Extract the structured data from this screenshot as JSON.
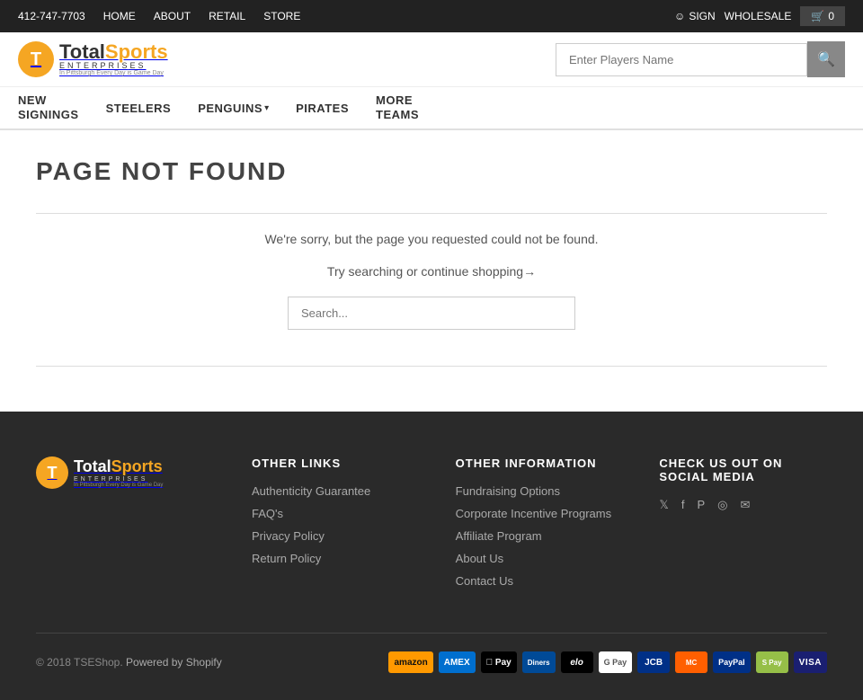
{
  "topbar": {
    "phone": "412-747-7703",
    "home_label": "HOME",
    "about_label": "ABOUT",
    "retail_label": "RETAIL",
    "store_label": "STORE",
    "sign_label": "SIGN",
    "wholesale_label": "WHOLESALE",
    "cart_count": "0"
  },
  "header": {
    "search_placeholder": "Enter Players Name"
  },
  "nav": {
    "items": [
      {
        "label": "NEW\nSIGNINGS",
        "has_arrow": false
      },
      {
        "label": "STEELERS",
        "has_arrow": false
      },
      {
        "label": "PENGUINS",
        "has_arrow": true
      },
      {
        "label": "PIRATES",
        "has_arrow": false
      },
      {
        "label": "MORE\nTEAMS",
        "has_arrow": false
      }
    ]
  },
  "main": {
    "title": "PAGE NOT FOUND",
    "error_message": "We're sorry, but the page you requested could not be found.",
    "search_prompt": "Try searching or ",
    "continue_link_text": "continue shopping→",
    "search_placeholder": "Search..."
  },
  "footer": {
    "other_links_title": "OTHER LINKS",
    "other_links": [
      {
        "label": "Authenticity Guarantee"
      },
      {
        "label": "FAQ's"
      },
      {
        "label": "Privacy Policy"
      },
      {
        "label": "Return Policy"
      }
    ],
    "other_info_title": "OTHER INFORMATION",
    "other_info": [
      {
        "label": "Fundraising Options"
      },
      {
        "label": "Corporate Incentive Programs"
      },
      {
        "label": "Affiliate Program"
      },
      {
        "label": "About Us"
      },
      {
        "label": "Contact Us"
      }
    ],
    "social_title": "CHECK US OUT ON\nSOCIAL MEDIA",
    "copyright": "© 2018 TSEShop.",
    "powered_by": "Powered by Shopify",
    "payment_methods": [
      {
        "label": "AMAZON",
        "class": "amazon"
      },
      {
        "label": "AMEX",
        "class": "amex"
      },
      {
        "label": "Apple Pay",
        "class": "apple"
      },
      {
        "label": "DINERS",
        "class": "diners"
      },
      {
        "label": "elo",
        "class": "elo"
      },
      {
        "label": "G Pay",
        "class": "google"
      },
      {
        "label": "JCB",
        "class": "jcb"
      },
      {
        "label": "MC",
        "class": "master"
      },
      {
        "label": "PayPal",
        "class": "paypal"
      },
      {
        "label": "S Pay",
        "class": "shopify"
      },
      {
        "label": "VISA",
        "class": "visa"
      }
    ]
  }
}
